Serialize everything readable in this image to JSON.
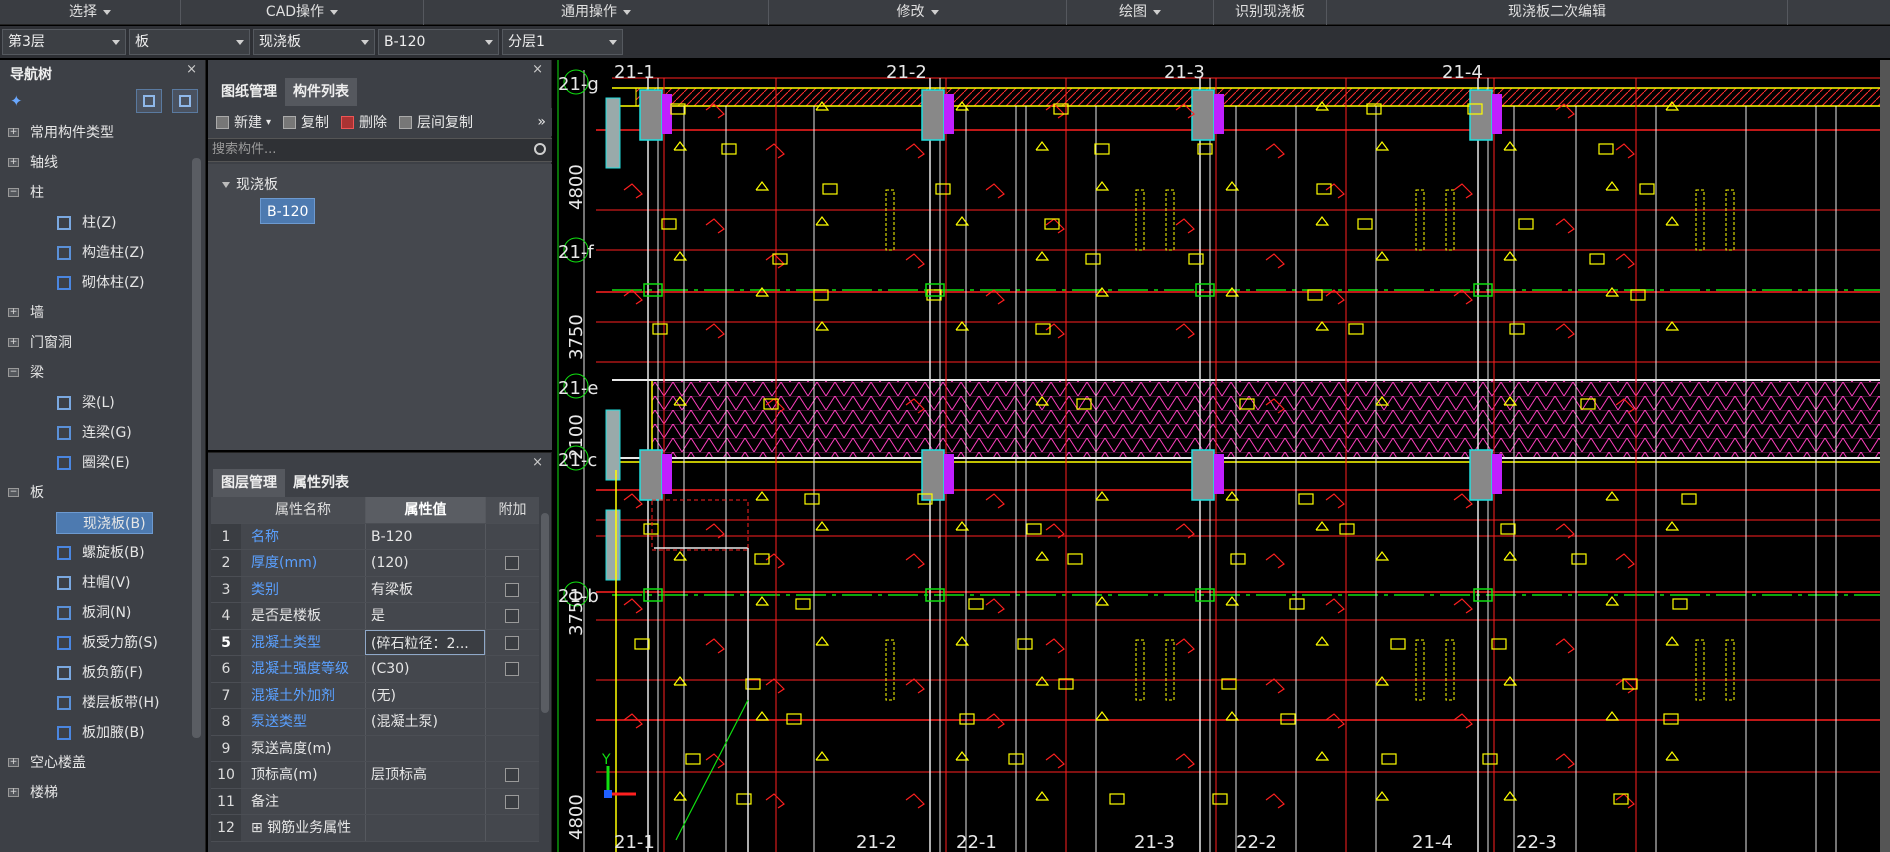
{
  "ribbon": [
    {
      "label": "选择",
      "caret": true,
      "w": 181
    },
    {
      "label": "CAD操作",
      "caret": true,
      "w": 243
    },
    {
      "label": "通用操作",
      "caret": true,
      "w": 345
    },
    {
      "label": "修改",
      "caret": true,
      "w": 298
    },
    {
      "label": "绘图",
      "caret": true,
      "w": 147
    },
    {
      "label": "识别现浇板",
      "caret": false,
      "w": 113
    },
    {
      "label": "现浇板二次编辑",
      "caret": false,
      "w": 461
    }
  ],
  "filters": [
    {
      "value": "第3层",
      "w": 124
    },
    {
      "value": "板",
      "w": 121
    },
    {
      "value": "现浇板",
      "w": 122
    },
    {
      "value": "B-120",
      "w": 121
    },
    {
      "value": "分层1",
      "w": 121
    }
  ],
  "nav": {
    "title": "导航树",
    "close": "×",
    "items": [
      {
        "level": 0,
        "label": "常用构件类型",
        "exp": "+"
      },
      {
        "level": 0,
        "label": "轴线",
        "exp": "+"
      },
      {
        "level": 0,
        "label": "柱",
        "exp": "−"
      },
      {
        "level": 1,
        "label": "柱(Z)",
        "icon": "column-icon"
      },
      {
        "level": 1,
        "label": "构造柱(Z)",
        "icon": "construct-column-icon"
      },
      {
        "level": 1,
        "label": "砌体柱(Z)",
        "icon": "masonry-column-icon"
      },
      {
        "level": 0,
        "label": "墙",
        "exp": "+"
      },
      {
        "level": 0,
        "label": "门窗洞",
        "exp": "+"
      },
      {
        "level": 0,
        "label": "梁",
        "exp": "−"
      },
      {
        "level": 1,
        "label": "梁(L)",
        "icon": "beam-icon"
      },
      {
        "level": 1,
        "label": "连梁(G)",
        "icon": "link-beam-icon"
      },
      {
        "level": 1,
        "label": "圈梁(E)",
        "icon": "ring-beam-icon"
      },
      {
        "level": 0,
        "label": "板",
        "exp": "−"
      },
      {
        "level": 1,
        "label": "现浇板(B)",
        "icon": "cast-slab-icon",
        "selected": true
      },
      {
        "level": 1,
        "label": "螺旋板(B)",
        "icon": "spiral-slab-icon"
      },
      {
        "level": 1,
        "label": "柱帽(V)",
        "icon": "column-cap-icon"
      },
      {
        "level": 1,
        "label": "板洞(N)",
        "icon": "slab-hole-icon"
      },
      {
        "level": 1,
        "label": "板受力筋(S)",
        "icon": "slab-rebar-icon"
      },
      {
        "level": 1,
        "label": "板负筋(F)",
        "icon": "negative-rebar-icon"
      },
      {
        "level": 1,
        "label": "楼层板带(H)",
        "icon": "slab-strip-icon"
      },
      {
        "level": 1,
        "label": "板加腋(B)",
        "icon": "slab-haunch-icon"
      },
      {
        "level": 0,
        "label": "空心楼盖",
        "exp": "+"
      },
      {
        "level": 0,
        "label": "楼梯",
        "exp": "+"
      }
    ]
  },
  "comp": {
    "tab1": "图纸管理",
    "tab2": "构件列表",
    "close": "×",
    "tools": [
      "新建",
      "复制",
      "删除",
      "层间复制"
    ],
    "more": "»",
    "search_placeholder": "搜索构件...",
    "tree_root": "现浇板",
    "tree_child": "B-120"
  },
  "prop": {
    "tab1": "图层管理",
    "tab2": "属性列表",
    "close": "×",
    "head": {
      "num": "",
      "name": "属性名称",
      "value": "属性值",
      "extra": "附加"
    },
    "rows": [
      {
        "n": "1",
        "name": "名称",
        "value": "B-120",
        "blue": true,
        "chk": false
      },
      {
        "n": "2",
        "name": "厚度(mm)",
        "value": "(120)",
        "blue": true,
        "chk": true
      },
      {
        "n": "3",
        "name": "类别",
        "value": "有梁板",
        "blue": true,
        "chk": true
      },
      {
        "n": "4",
        "name": "是否是楼板",
        "value": "是",
        "blue": false,
        "chk": true
      },
      {
        "n": "5",
        "name": "混凝土类型",
        "value": "(碎石粒径：2...",
        "blue": true,
        "chk": true,
        "cur": true
      },
      {
        "n": "6",
        "name": "混凝土强度等级",
        "value": "(C30)",
        "blue": true,
        "chk": true
      },
      {
        "n": "7",
        "name": "混凝土外加剂",
        "value": "(无)",
        "blue": true,
        "chk": false
      },
      {
        "n": "8",
        "name": "泵送类型",
        "value": "(混凝土泵)",
        "blue": true,
        "chk": false
      },
      {
        "n": "9",
        "name": "泵送高度(m)",
        "value": "",
        "blue": false,
        "chk": false
      },
      {
        "n": "10",
        "name": "顶标高(m)",
        "value": "层顶标高",
        "blue": false,
        "chk": true
      },
      {
        "n": "11",
        "name": "备注",
        "value": "",
        "blue": false,
        "chk": true
      },
      {
        "n": "12",
        "name": "⊞ 钢筋业务属性",
        "value": "",
        "blue": false,
        "chk": false
      }
    ]
  },
  "cad": {
    "axis_top": [
      "21-1",
      "21-2",
      "21-3",
      "21-4"
    ],
    "axis_bottom": [
      "21-1",
      "21-2",
      "22-1",
      "21-3",
      "22-2",
      "21-4",
      "22-3"
    ],
    "axis_left": [
      "21-g",
      "21-f",
      "21-e",
      "21-c",
      "21-b"
    ],
    "dims": [
      "4800",
      "3750",
      "2100",
      "3750",
      "4800"
    ],
    "ucs_y": "Y",
    "colors": {
      "red": "#ff2020",
      "yellow": "#ffff00",
      "green": "#10e010",
      "white": "#e8e8e8",
      "cyan": "#20e0e0",
      "magenta": "#c020ff",
      "pink": "#ff60ff"
    }
  }
}
